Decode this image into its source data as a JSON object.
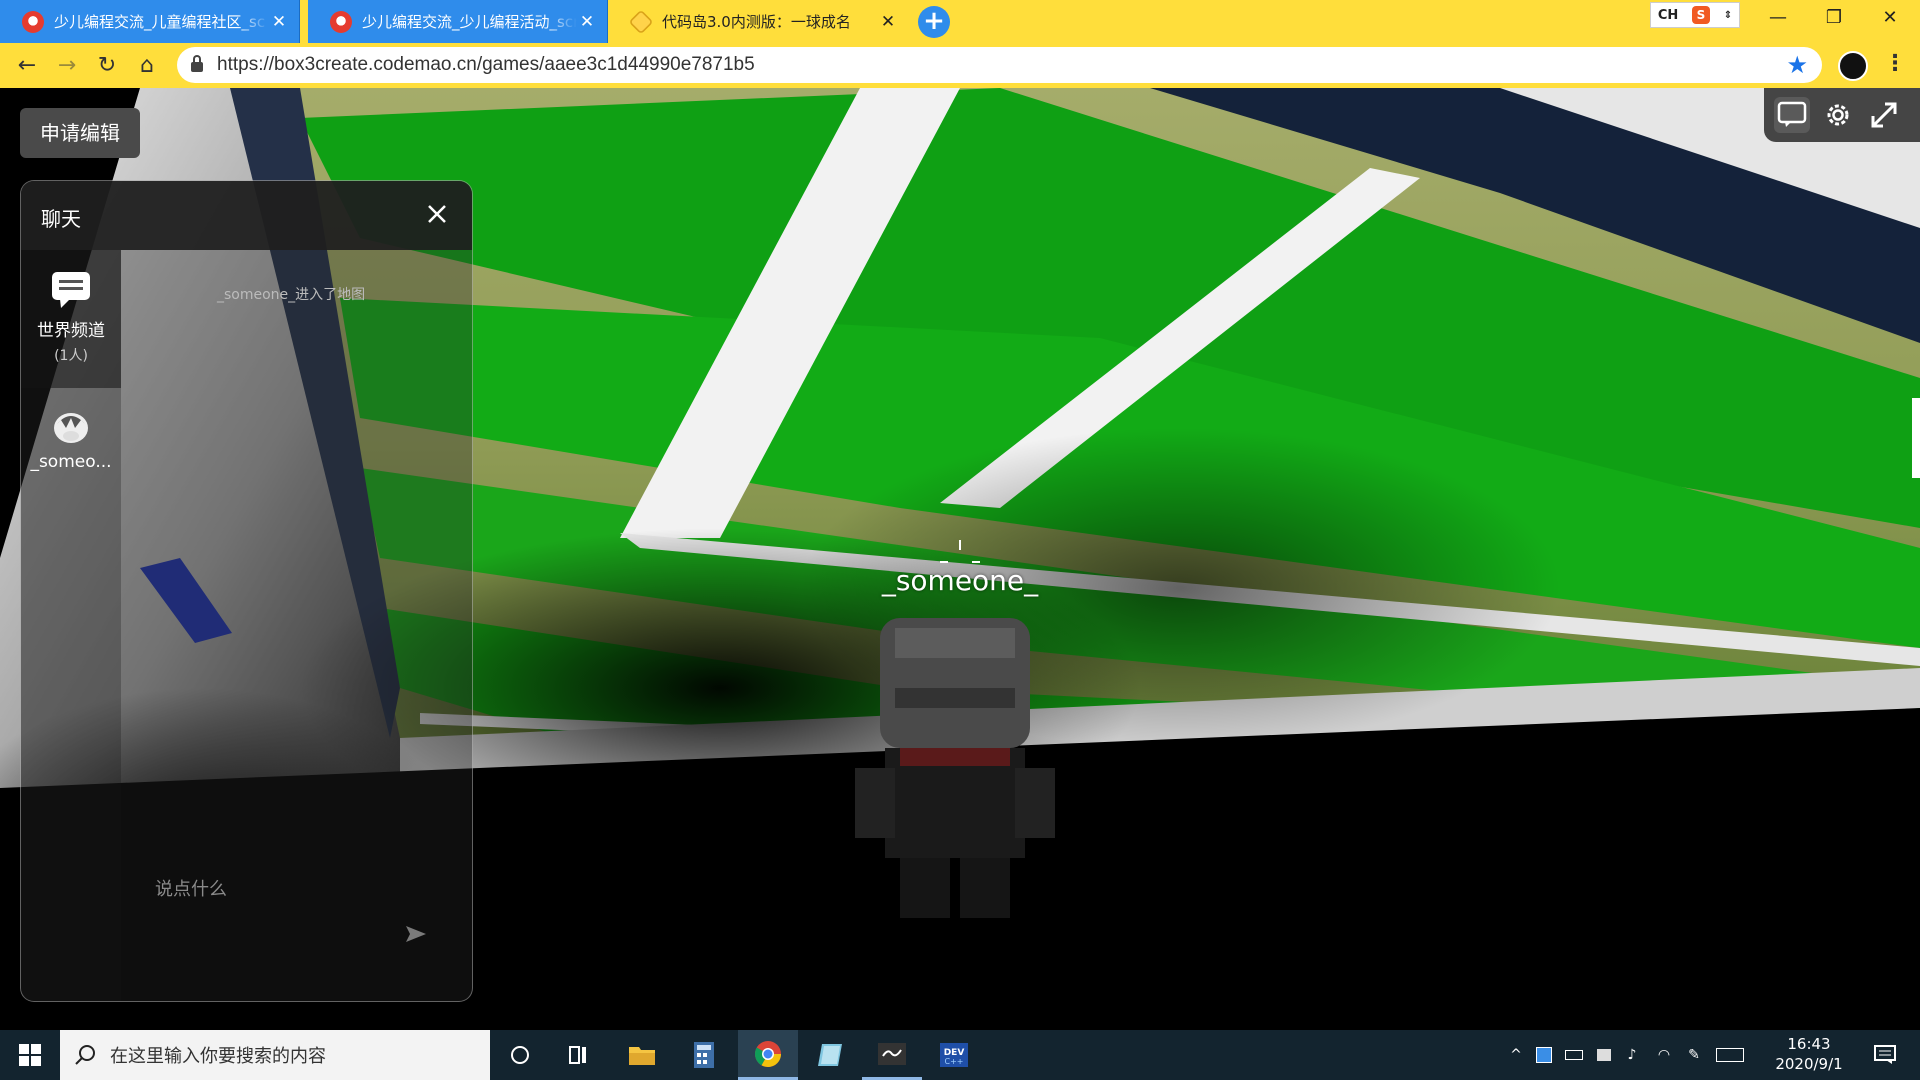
{
  "browser": {
    "tabs": [
      {
        "title": "少儿编程交流_儿童编程社区_sc",
        "favicon": "codemao-icon"
      },
      {
        "title": "少儿编程交流_少儿编程活动_scr",
        "favicon": "codemao-icon"
      },
      {
        "title": "代码岛3.0内测版：一球成名",
        "favicon": "box3-icon",
        "active": true
      }
    ],
    "new_tab": "+",
    "url": "https://box3create.codemao.cn/games/aaee3c1d44990e7871b5",
    "ime": {
      "lang": "CH",
      "sogou": "S"
    },
    "accent_color": "#ffde3b"
  },
  "game": {
    "apply_edit_label": "申请编辑",
    "player_nametag": "_someone_",
    "chat": {
      "title": "聊天",
      "channels": [
        {
          "label": "世界频道",
          "count": "(1人)",
          "icon": "chat-bubble-icon"
        },
        {
          "label": "_someo...",
          "icon": "avatar-icon"
        }
      ],
      "messages": [
        "_someone_进入了地图"
      ],
      "input_placeholder": "说点什么"
    }
  },
  "taskbar": {
    "search_placeholder": "在这里输入你要搜索的内容",
    "time": "16:43",
    "date": "2020/9/1"
  }
}
